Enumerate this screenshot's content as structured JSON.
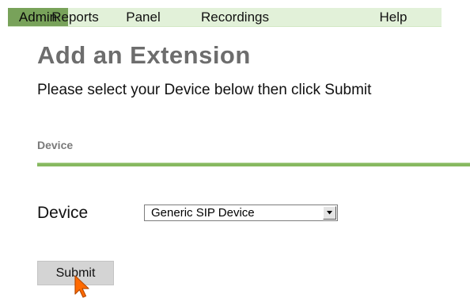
{
  "menu": {
    "tabs": [
      {
        "label": "Admin",
        "active": true
      },
      {
        "label": "Reports",
        "active": false
      },
      {
        "label": "Panel",
        "active": false
      },
      {
        "label": "Recordings",
        "active": false
      },
      {
        "label": "Help",
        "active": false
      }
    ]
  },
  "page": {
    "title": "Add an Extension",
    "instructions": "Please select your Device below then click Submit"
  },
  "section": {
    "label": "Device"
  },
  "form": {
    "device_label": "Device",
    "device_select": {
      "selected": "Generic SIP Device"
    },
    "submit_label": "Submit"
  },
  "colors": {
    "menu_background": "#e2f1d9",
    "active_tab": "#78a25a",
    "divider": "#87b960",
    "title": "#6d6d6d",
    "cursor": "#ff6a00"
  },
  "icons": {
    "select_arrow": "chevron-down-icon",
    "pointer": "mouse-pointer-icon"
  }
}
